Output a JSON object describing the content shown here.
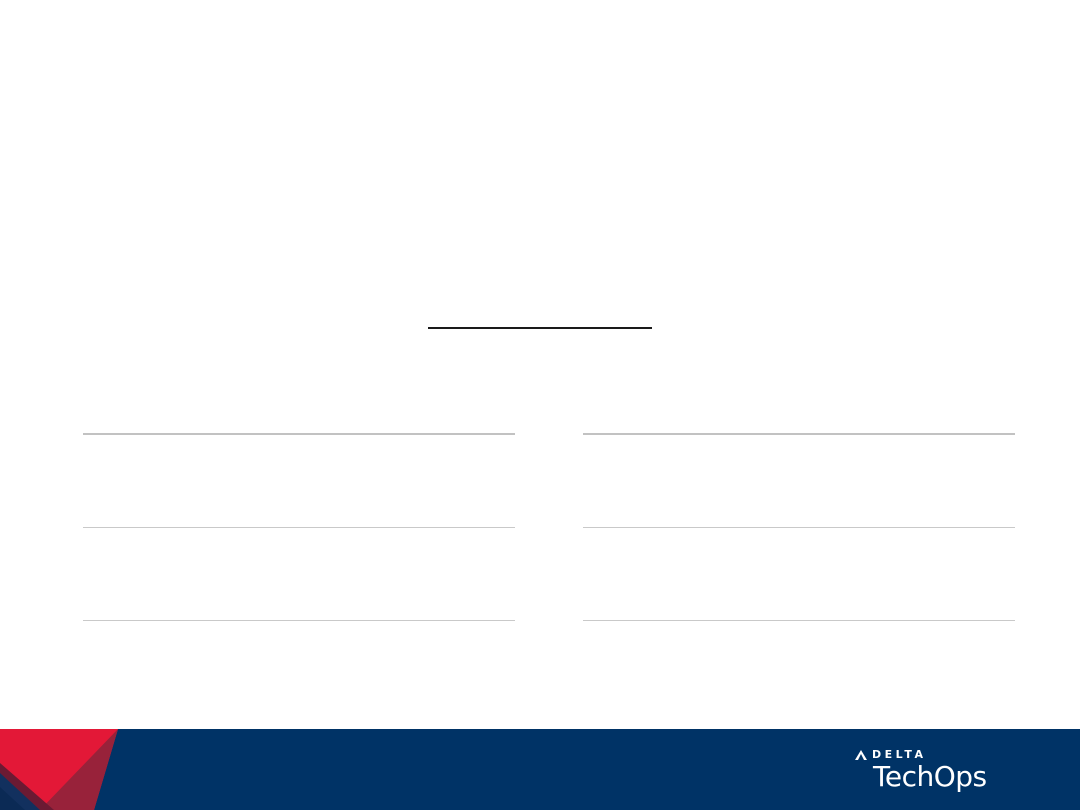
{
  "footer": {
    "brand": {
      "company": "DELTA",
      "product": "TechOps"
    },
    "colors": {
      "band": "#003366",
      "widget_red": "#e31837",
      "widget_dark_red": "#98223a"
    },
    "icons": {
      "brand_mark": "delta-triangle-icon",
      "corner_graphic": "delta-widget-icon"
    }
  }
}
